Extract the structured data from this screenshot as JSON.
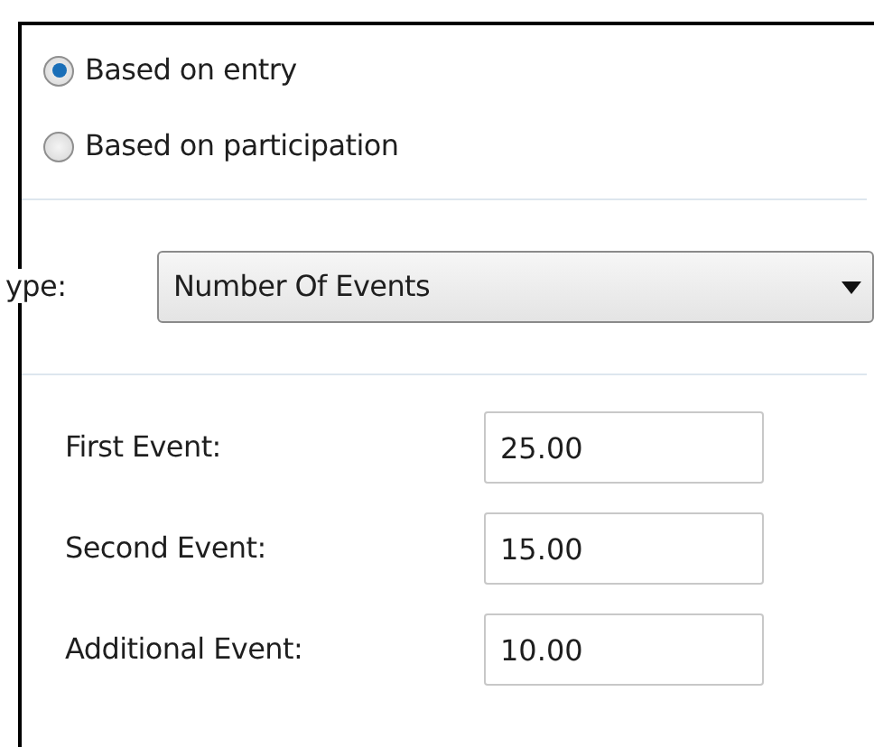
{
  "calculation": {
    "options": [
      {
        "label": "Based on entry",
        "selected": true
      },
      {
        "label": "Based on participation",
        "selected": false
      }
    ]
  },
  "type": {
    "label": "ype:",
    "value": "Number Of Events"
  },
  "fields": [
    {
      "label": "First Event:",
      "value": "25.00"
    },
    {
      "label": "Second Event:",
      "value": "15.00"
    },
    {
      "label": "Additional Event:",
      "value": "10.00"
    }
  ]
}
